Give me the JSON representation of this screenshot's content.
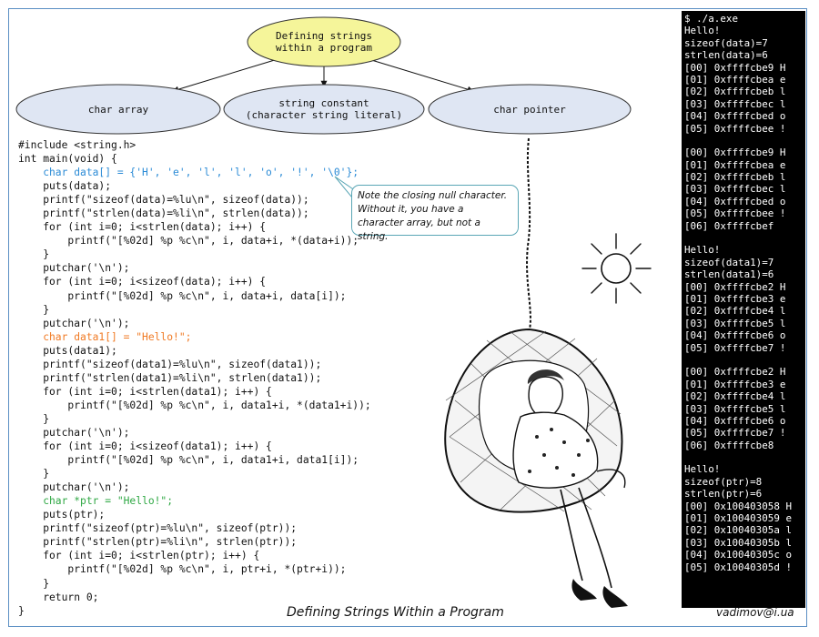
{
  "diagram": {
    "root": "Defining strings within a program",
    "root_lines": [
      "Defining strings",
      "within a program"
    ],
    "children": [
      {
        "lines": [
          "char array"
        ]
      },
      {
        "lines": [
          "string constant",
          "(character string literal)"
        ]
      },
      {
        "lines": [
          "char pointer"
        ]
      }
    ],
    "colors": {
      "root_fill": "#f5f59a",
      "child_fill": "#dfe6f3",
      "node_stroke": "#333333"
    }
  },
  "code": [
    {
      "text": "#include <string.h>",
      "style": "plain"
    },
    {
      "text": "int main(void) {",
      "style": "plain"
    },
    {
      "text": "    char data[] = {'H', 'e', 'l', 'l', 'o', '!', '\\0'};",
      "style": "blue"
    },
    {
      "text": "    puts(data);",
      "style": "plain"
    },
    {
      "text": "    printf(\"sizeof(data)=%lu\\n\", sizeof(data));",
      "style": "plain"
    },
    {
      "text": "    printf(\"strlen(data)=%li\\n\", strlen(data));",
      "style": "plain"
    },
    {
      "text": "    for (int i=0; i<strlen(data); i++) {",
      "style": "plain"
    },
    {
      "text": "        printf(\"[%02d] %p %c\\n\", i, data+i, *(data+i));",
      "style": "plain"
    },
    {
      "text": "    }",
      "style": "plain"
    },
    {
      "text": "    putchar('\\n');",
      "style": "plain"
    },
    {
      "text": "    for (int i=0; i<sizeof(data); i++) {",
      "style": "plain"
    },
    {
      "text": "        printf(\"[%02d] %p %c\\n\", i, data+i, data[i]);",
      "style": "plain"
    },
    {
      "text": "    }",
      "style": "plain"
    },
    {
      "text": "    putchar('\\n');",
      "style": "plain"
    },
    {
      "text": "    char data1[] = \"Hello!\";",
      "style": "orange"
    },
    {
      "text": "    puts(data1);",
      "style": "plain"
    },
    {
      "text": "    printf(\"sizeof(data1)=%lu\\n\", sizeof(data1));",
      "style": "plain"
    },
    {
      "text": "    printf(\"strlen(data1)=%li\\n\", strlen(data1));",
      "style": "plain"
    },
    {
      "text": "    for (int i=0; i<strlen(data1); i++) {",
      "style": "plain"
    },
    {
      "text": "        printf(\"[%02d] %p %c\\n\", i, data1+i, *(data1+i));",
      "style": "plain"
    },
    {
      "text": "    }",
      "style": "plain"
    },
    {
      "text": "    putchar('\\n');",
      "style": "plain"
    },
    {
      "text": "    for (int i=0; i<sizeof(data1); i++) {",
      "style": "plain"
    },
    {
      "text": "        printf(\"[%02d] %p %c\\n\", i, data1+i, data1[i]);",
      "style": "plain"
    },
    {
      "text": "    }",
      "style": "plain"
    },
    {
      "text": "    putchar('\\n');",
      "style": "plain"
    },
    {
      "text": "    char *ptr = \"Hello!\";",
      "style": "green"
    },
    {
      "text": "    puts(ptr);",
      "style": "plain"
    },
    {
      "text": "    printf(\"sizeof(ptr)=%lu\\n\", sizeof(ptr));",
      "style": "plain"
    },
    {
      "text": "    printf(\"strlen(ptr)=%li\\n\", strlen(ptr));",
      "style": "plain"
    },
    {
      "text": "    for (int i=0; i<strlen(ptr); i++) {",
      "style": "plain"
    },
    {
      "text": "        printf(\"[%02d] %p %c\\n\", i, ptr+i, *(ptr+i));",
      "style": "plain"
    },
    {
      "text": "    }",
      "style": "plain"
    },
    {
      "text": "    return 0;",
      "style": "plain"
    },
    {
      "text": "}",
      "style": "plain"
    }
  ],
  "code_colors": {
    "blue": "#2b8bd6",
    "orange": "#f07a24",
    "green": "#2fa844"
  },
  "note": "Note the closing null character. Without it, you have a character array, but not a string.",
  "console": [
    "$ ./a.exe",
    "Hello!",
    "sizeof(data)=7",
    "strlen(data)=6",
    "[00] 0xffffcbe9 H",
    "[01] 0xffffcbea e",
    "[02] 0xffffcbeb l",
    "[03] 0xffffcbec l",
    "[04] 0xffffcbed o",
    "[05] 0xffffcbee !",
    "",
    "[00] 0xffffcbe9 H",
    "[01] 0xffffcbea e",
    "[02] 0xffffcbeb l",
    "[03] 0xffffcbec l",
    "[04] 0xffffcbed o",
    "[05] 0xffffcbee !",
    "[06] 0xffffcbef",
    "",
    "Hello!",
    "sizeof(data1)=7",
    "strlen(data1)=6",
    "[00] 0xffffcbe2 H",
    "[01] 0xffffcbe3 e",
    "[02] 0xffffcbe4 l",
    "[03] 0xffffcbe5 l",
    "[04] 0xffffcbe6 o",
    "[05] 0xffffcbe7 !",
    "",
    "[00] 0xffffcbe2 H",
    "[01] 0xffffcbe3 e",
    "[02] 0xffffcbe4 l",
    "[03] 0xffffcbe5 l",
    "[04] 0xffffcbe6 o",
    "[05] 0xffffcbe7 !",
    "[06] 0xffffcbe8",
    "",
    "Hello!",
    "sizeof(ptr)=8",
    "strlen(ptr)=6",
    "[00] 0x100403058 H",
    "[01] 0x100403059 e",
    "[02] 0x10040305a l",
    "[03] 0x10040305b l",
    "[04] 0x10040305c o",
    "[05] 0x10040305d !"
  ],
  "caption": "Defining Strings Within a Program",
  "author": "vadimov@i.ua",
  "illustration": {
    "depicts": "woman sitting in a hanging wicker egg chair under a sun",
    "icons": [
      "sun-icon",
      "hanging-chair-icon",
      "woman-figure-icon"
    ]
  }
}
